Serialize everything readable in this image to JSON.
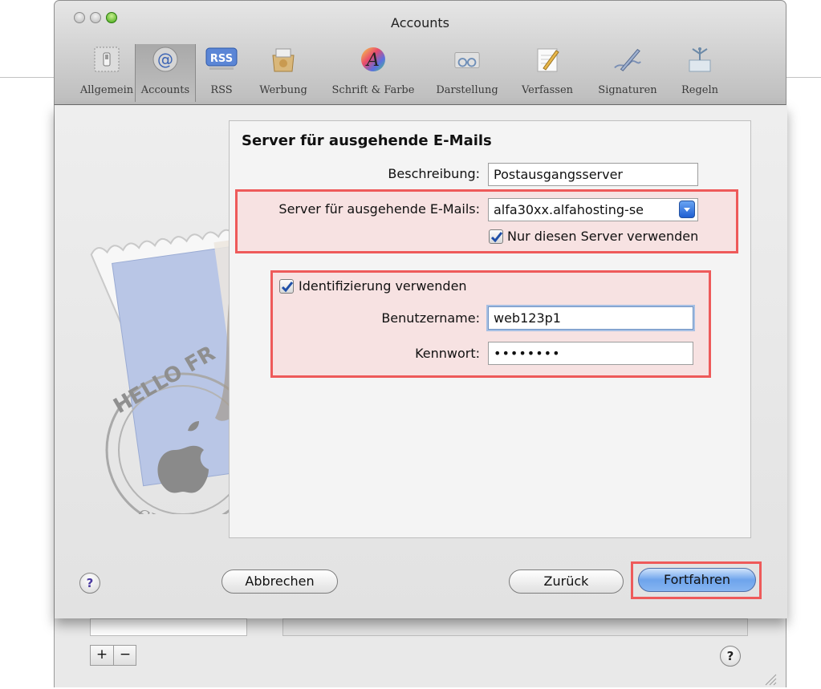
{
  "window": {
    "title": "Accounts"
  },
  "toolbar": {
    "items": [
      {
        "label": "Allgemein",
        "icon": "switch-icon"
      },
      {
        "label": "Accounts",
        "icon": "at-sign-icon"
      },
      {
        "label": "RSS",
        "icon": "rss-icon"
      },
      {
        "label": "Werbung",
        "icon": "junk-mail-icon"
      },
      {
        "label": "Schrift & Farbe",
        "icon": "font-color-icon"
      },
      {
        "label": "Darstellung",
        "icon": "glasses-icon"
      },
      {
        "label": "Verfassen",
        "icon": "pencil-paper-icon"
      },
      {
        "label": "Signaturen",
        "icon": "signature-pen-icon"
      },
      {
        "label": "Regeln",
        "icon": "rules-icon"
      }
    ],
    "rss_badge": "RSS"
  },
  "form": {
    "heading": "Server für ausgehende E-Mails",
    "description_label": "Beschreibung:",
    "description_value": "Postausgangsserver",
    "server_label": "Server für ausgehende E-Mails:",
    "server_value": "alfa30xx.alfahosting-se",
    "only_server_label": "Nur diesen Server verwenden",
    "only_server_checked": true,
    "auth_label": "Identifizierung verwenden",
    "auth_checked": true,
    "username_label": "Benutzername:",
    "username_value": "web123p1",
    "password_label": "Kennwort:",
    "password_value": "••••••••"
  },
  "buttons": {
    "help": "?",
    "cancel": "Abbrechen",
    "back": "Zurück",
    "continue": "Fortfahren"
  },
  "footer": {
    "add": "+",
    "remove": "−",
    "help": "?"
  },
  "stamp": {
    "postmark_text": "HELLO FR",
    "postmark_city": "CUPERTINO CA"
  },
  "colors": {
    "highlight": "#ee5a5a",
    "accent_blue": "#3d7fe0",
    "checkmark": "#1f4fa8"
  }
}
